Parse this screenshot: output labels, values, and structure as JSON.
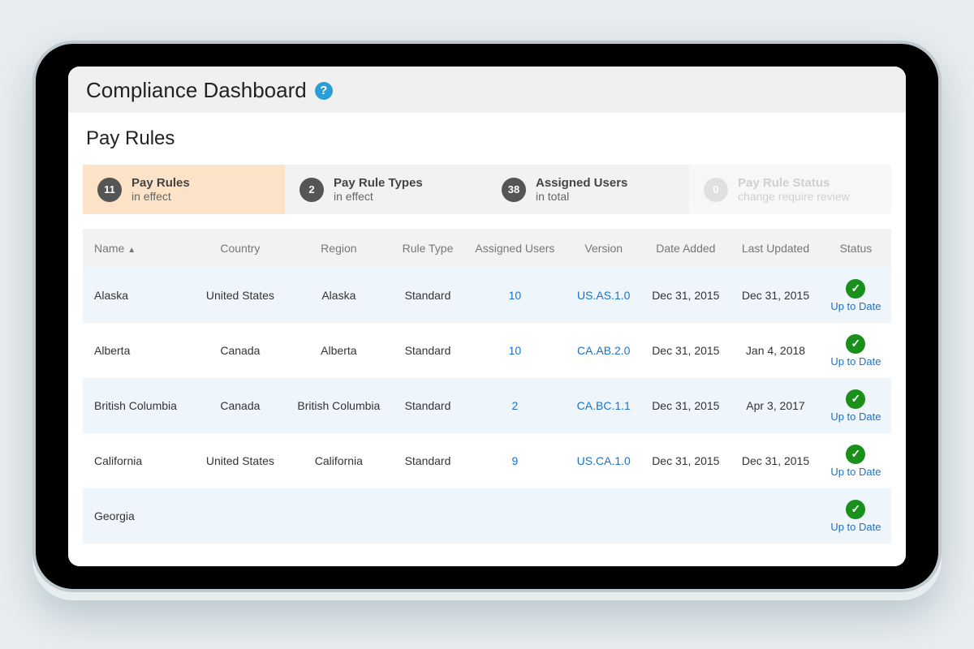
{
  "header": {
    "title": "Compliance Dashboard",
    "help_symbol": "?"
  },
  "panel": {
    "title": "Pay Rules"
  },
  "summary": [
    {
      "count": "11",
      "label": "Pay Rules",
      "sub": "in effect",
      "state": "active"
    },
    {
      "count": "2",
      "label": "Pay Rule Types",
      "sub": "in effect",
      "state": "normal"
    },
    {
      "count": "38",
      "label": "Assigned Users",
      "sub": "in total",
      "state": "normal"
    },
    {
      "count": "0",
      "label": "Pay Rule Status",
      "sub": "change require review",
      "state": "disabled"
    }
  ],
  "columns": {
    "name": "Name",
    "sort_indicator": "▲",
    "country": "Country",
    "region": "Region",
    "rule_type": "Rule Type",
    "assigned_users": "Assigned Users",
    "version": "Version",
    "date_added": "Date Added",
    "last_updated": "Last Updated",
    "status": "Status"
  },
  "status_text": {
    "up_to_date": "Up to Date",
    "check_symbol": "✓"
  },
  "rows": [
    {
      "name": "Alaska",
      "country": "United States",
      "region": "Alaska",
      "rule_type": "Standard",
      "assigned_users": "10",
      "version": "US.AS.1.0",
      "date_added": "Dec 31, 2015",
      "last_updated": "Dec 31, 2015"
    },
    {
      "name": "Alberta",
      "country": "Canada",
      "region": "Alberta",
      "rule_type": "Standard",
      "assigned_users": "10",
      "version": "CA.AB.2.0",
      "date_added": "Dec 31, 2015",
      "last_updated": "Jan 4, 2018"
    },
    {
      "name": "British Columbia",
      "country": "Canada",
      "region": "British Columbia",
      "rule_type": "Standard",
      "assigned_users": "2",
      "version": "CA.BC.1.1",
      "date_added": "Dec 31, 2015",
      "last_updated": "Apr 3, 2017"
    },
    {
      "name": "California",
      "country": "United States",
      "region": "California",
      "rule_type": "Standard",
      "assigned_users": "9",
      "version": "US.CA.1.0",
      "date_added": "Dec 31, 2015",
      "last_updated": "Dec 31, 2015"
    },
    {
      "name": "Georgia",
      "country": "",
      "region": "",
      "rule_type": "",
      "assigned_users": "",
      "version": "",
      "date_added": "",
      "last_updated": ""
    }
  ]
}
